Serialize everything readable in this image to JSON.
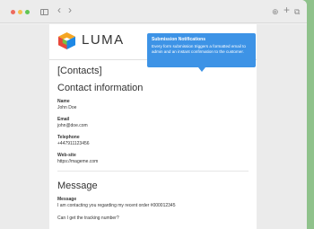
{
  "browser": {
    "nav_back": "‹",
    "nav_forward": "›",
    "download_icon": "⊕",
    "new_tab_icon": "+",
    "tabs_icon": "⧉"
  },
  "logo": {
    "text": "LUMA",
    "colors": [
      "#f5a623",
      "#e8473a",
      "#7bc043",
      "#1e88e5"
    ]
  },
  "page": {
    "heading": "[Contacts]",
    "contact_section_title": "Contact information",
    "fields": [
      {
        "label": "Name",
        "value": "John Doe"
      },
      {
        "label": "Email",
        "value": "john@doe.com"
      },
      {
        "label": "Telephone",
        "value": "+447911123456"
      },
      {
        "label": "Web-site",
        "value": "https://mageme.com"
      }
    ],
    "message_section_title": "Message",
    "message_label": "Message",
    "message_line1": "I am contacting you regarding my recent order #000012345",
    "message_line2": "Can I get the tracking number?"
  },
  "tooltip": {
    "title": "Submission Notifications",
    "text": "Every form submission triggers a formatted email to admin and an instant confirmation to the customer."
  }
}
